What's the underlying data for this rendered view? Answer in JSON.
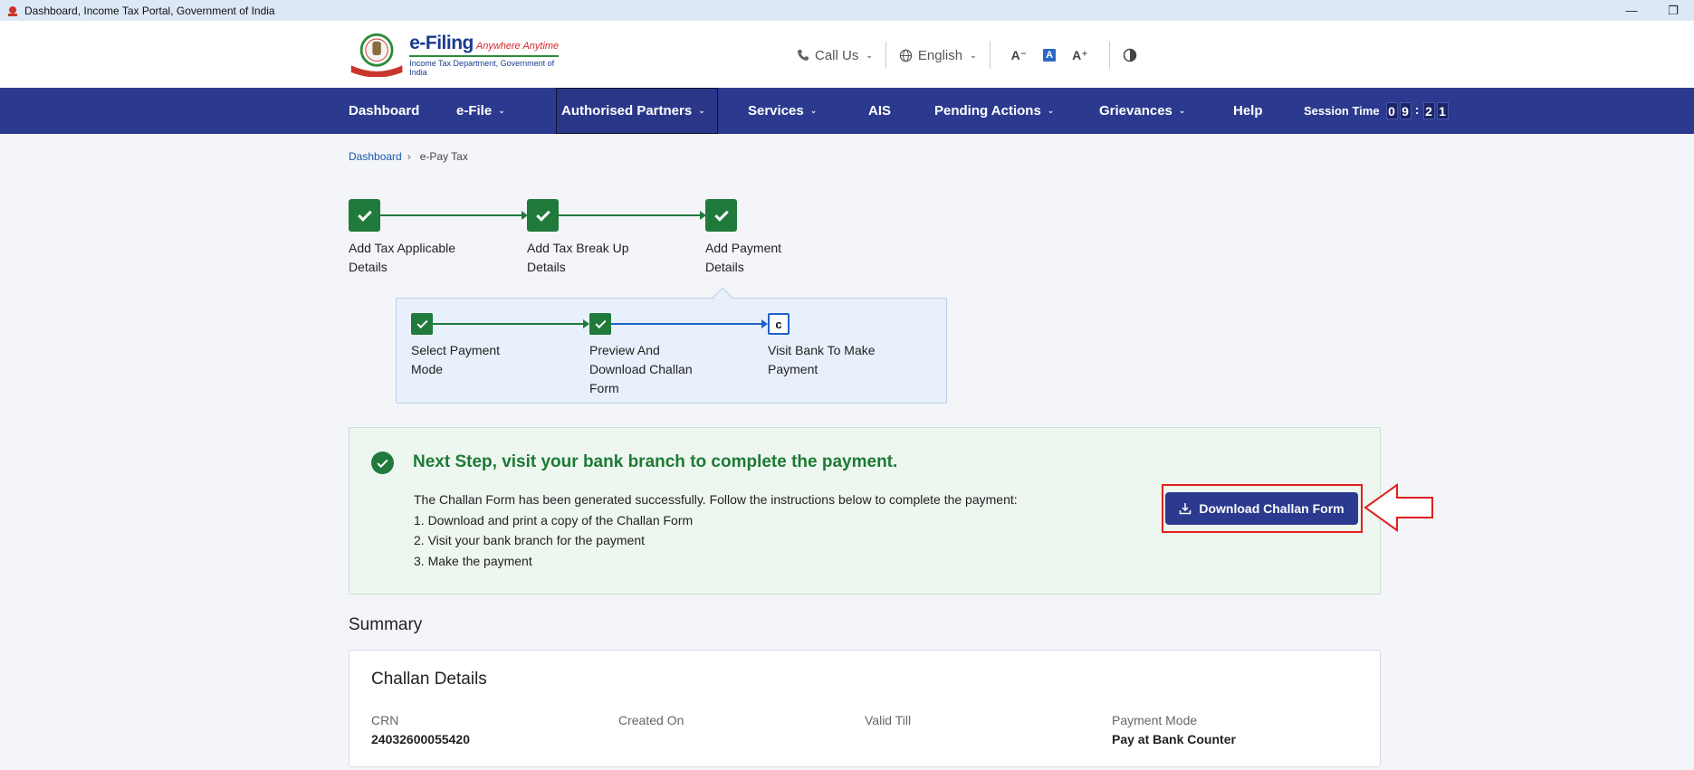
{
  "window": {
    "title": "Dashboard, Income Tax Portal, Government of India"
  },
  "header": {
    "brand": "e-Filing",
    "tagline": "Anywhere Anytime",
    "department": "Income Tax Department, Government of India",
    "call_us": "Call Us",
    "language": "English",
    "font_decrease": "A⁻",
    "font_default": "A",
    "font_increase": "A⁺"
  },
  "nav": {
    "items": [
      {
        "label": "Dashboard"
      },
      {
        "label": "e-File"
      },
      {
        "label": "Authorised Partners"
      },
      {
        "label": "Services"
      },
      {
        "label": "AIS"
      },
      {
        "label": "Pending Actions"
      },
      {
        "label": "Grievances"
      },
      {
        "label": "Help"
      }
    ],
    "session_label": "Session Time",
    "session_digits": [
      "0",
      "9",
      "2",
      "1"
    ],
    "session_colon": ":"
  },
  "breadcrumb": {
    "root": "Dashboard",
    "current": "e-Pay Tax"
  },
  "steps": [
    {
      "label": "Add Tax Applicable Details",
      "line1": "Add Tax Applicable",
      "line2": "Details"
    },
    {
      "label": "Add Tax Break Up Details",
      "line1": "Add Tax Break Up",
      "line2": "Details"
    },
    {
      "label": "Add Payment Details",
      "line1": "Add Payment",
      "line2": "Details"
    }
  ],
  "sub_steps": [
    {
      "line1": "Select Payment",
      "line2": "Mode",
      "line3": ""
    },
    {
      "line1": "Preview And",
      "line2": "Download Challan",
      "line3": "Form"
    },
    {
      "line1": "Visit Bank To Make",
      "line2": "Payment",
      "line3": "",
      "marker": "c"
    }
  ],
  "success": {
    "heading": "Next Step, visit your bank branch to complete the payment.",
    "intro": "The Challan Form has been generated successfully. Follow the instructions below to complete the payment:",
    "instructions": [
      "1. Download and print a copy of the Challan Form",
      "2. Visit your bank branch for the payment",
      "3. Make the payment"
    ],
    "download_label": "Download Challan Form"
  },
  "summary": {
    "title": "Summary",
    "card_title": "Challan Details",
    "fields": [
      {
        "label": "CRN",
        "value": "24032600055420"
      },
      {
        "label": "Created On",
        "value": ""
      },
      {
        "label": "Valid Till",
        "value": ""
      },
      {
        "label": "Payment Mode",
        "value": "Pay at Bank Counter"
      }
    ]
  },
  "colors": {
    "nav_bg": "#2b3a8e",
    "step_done": "#207a3c",
    "step_current": "#1f63c9",
    "success_text": "#1e7a34",
    "highlight_red": "#e0201e"
  }
}
